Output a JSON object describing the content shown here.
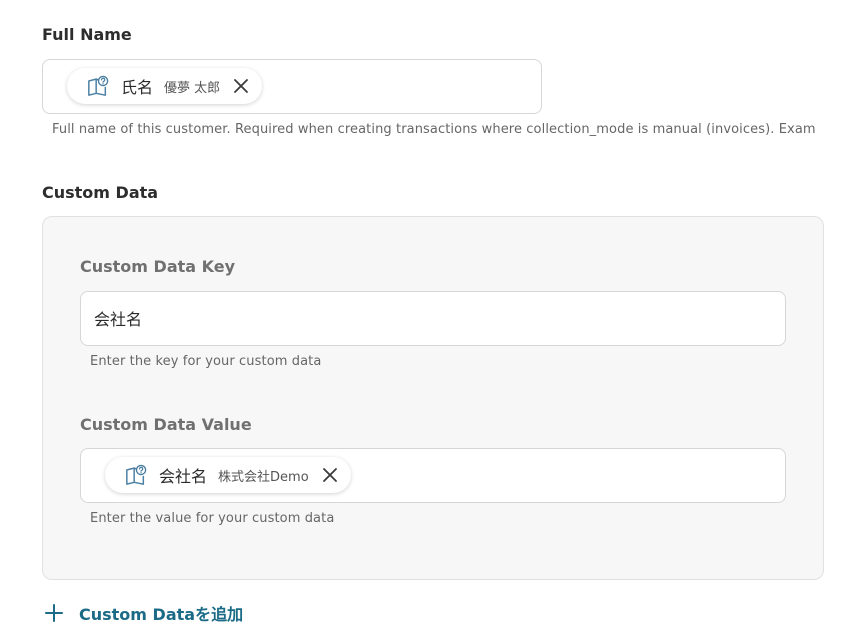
{
  "full_name": {
    "label": "Full Name",
    "chip": {
      "label": "氏名",
      "value": "優夢 太郎",
      "icon": "book-question-icon"
    },
    "help": "Full name of this customer. Required when creating transactions where collection_mode is manual (invoices). Exam"
  },
  "custom_data": {
    "label": "Custom Data",
    "key": {
      "label": "Custom Data Key",
      "value": "会社名",
      "help": "Enter the key for your custom data"
    },
    "value": {
      "label": "Custom Data Value",
      "chip": {
        "label": "会社名",
        "value": "株式会社Demo",
        "icon": "book-question-icon"
      },
      "help": "Enter the value for your custom data"
    },
    "add_button": {
      "label": "Custom Dataを追加",
      "icon": "plus-icon"
    }
  },
  "colors": {
    "accent": "#1b6b87",
    "icon": "#4a7fa3"
  }
}
